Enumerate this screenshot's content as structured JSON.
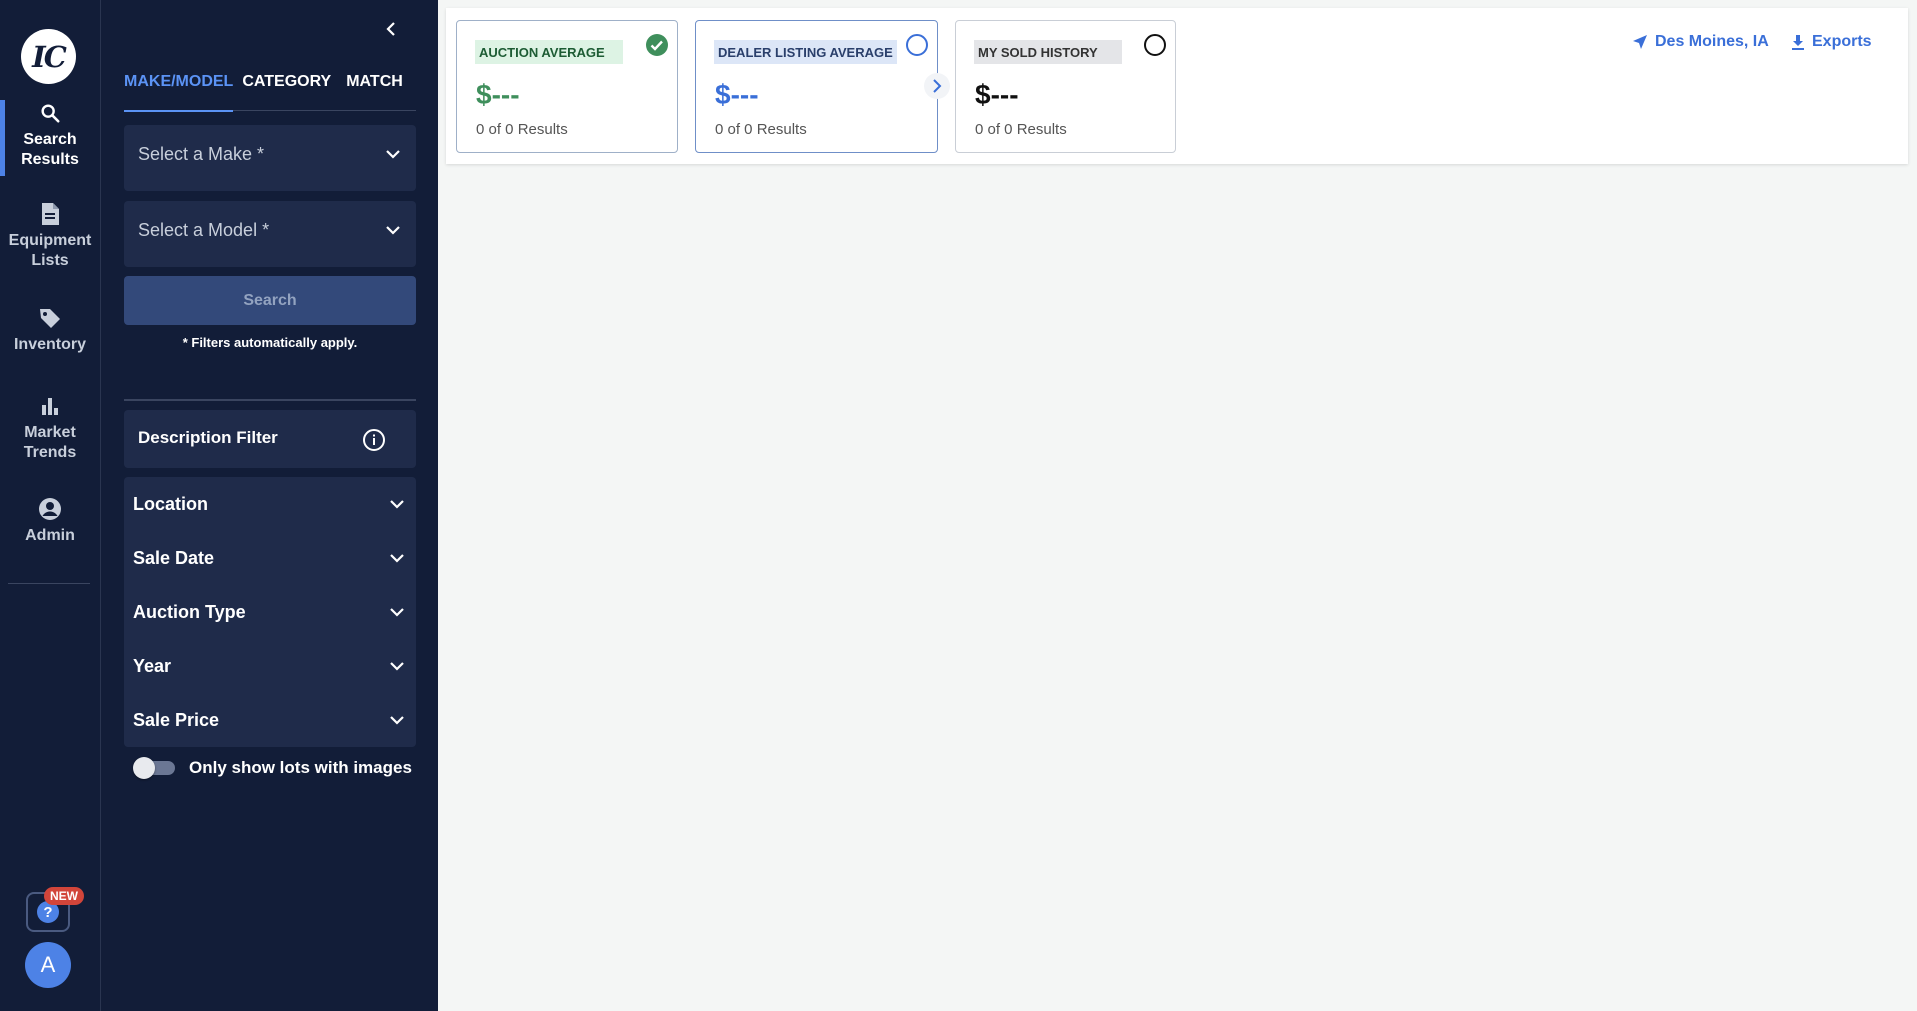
{
  "nav": {
    "logo_text": "IC",
    "items": [
      {
        "label": "Search Results",
        "icon": "search-icon",
        "active": true
      },
      {
        "label": "Equipment Lists",
        "icon": "document-icon",
        "active": false
      },
      {
        "label": "Inventory",
        "icon": "tag-icon",
        "active": false
      },
      {
        "label": "Market Trends",
        "icon": "bar-chart-icon",
        "active": false
      },
      {
        "label": "Admin",
        "icon": "account-circle-icon",
        "active": false
      }
    ],
    "help_badge": "NEW",
    "help_icon_text": "?",
    "avatar_initial": "A"
  },
  "filters": {
    "tabs": [
      {
        "label": "MAKE/MODEL",
        "active": true
      },
      {
        "label": "CATEGORY",
        "active": false
      },
      {
        "label": "MATCH",
        "active": false
      }
    ],
    "make_placeholder": "Select a Make *",
    "model_placeholder": "Select a Model *",
    "search_label": "Search",
    "auto_apply_note": "* Filters automatically apply.",
    "description_filter_label": "Description Filter",
    "accordions": [
      "Location",
      "Sale Date",
      "Auction Type",
      "Year",
      "Sale Price"
    ],
    "images_toggle_label": "Only show lots with images",
    "images_toggle_on": false
  },
  "summary": {
    "cards": [
      {
        "tag": "AUCTION AVERAGE",
        "price": "$---",
        "count": "0 of 0 Results",
        "selected": true
      },
      {
        "tag": "DEALER LISTING AVERAGE",
        "price": "$---",
        "count": "0 of 0 Results",
        "selected": false
      },
      {
        "tag": "MY SOLD HISTORY",
        "price": "$---",
        "count": "0 of 0 Results",
        "selected": false
      }
    ],
    "location_label": "Des Moines, IA",
    "exports_label": "Exports"
  },
  "colors": {
    "nav_bg": "#121d38",
    "accent": "#5b93f5",
    "success": "#3f8f5c",
    "badge": "#d2453a"
  }
}
